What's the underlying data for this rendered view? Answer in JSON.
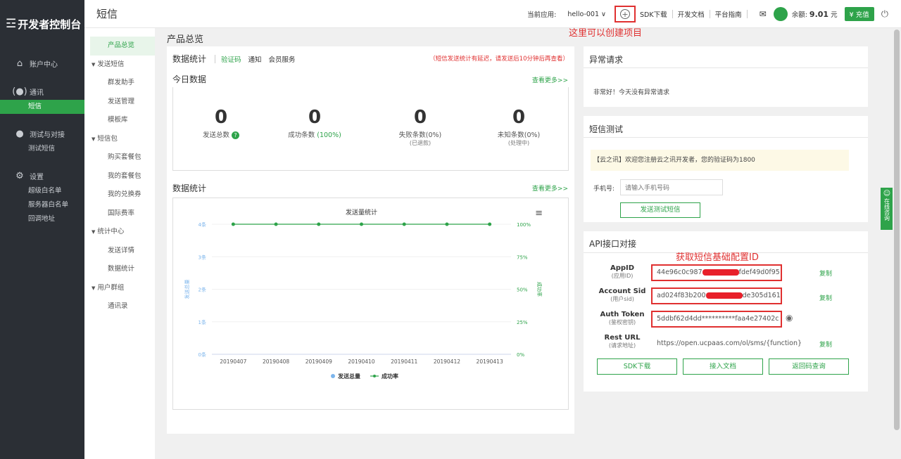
{
  "nav1": {
    "logo": "开发者控制台",
    "groups": [
      {
        "head": "账户中心",
        "subs": []
      },
      {
        "head": "通讯",
        "subs": [
          {
            "label": "短信",
            "active": true
          }
        ]
      },
      {
        "head": "测试与对接",
        "subs": [
          {
            "label": "测试短信",
            "active": false
          }
        ]
      },
      {
        "head": "设置",
        "subs": [
          {
            "label": "超级白名单"
          },
          {
            "label": "服务器白名单"
          },
          {
            "label": "回调地址"
          }
        ]
      }
    ]
  },
  "nav2": {
    "items": [
      {
        "label": "产品总览",
        "type": "item",
        "active": true
      },
      {
        "label": "发送短信",
        "type": "group"
      },
      {
        "label": "群发助手",
        "type": "item"
      },
      {
        "label": "发送管理",
        "type": "item"
      },
      {
        "label": "模板库",
        "type": "item"
      },
      {
        "label": "短信包",
        "type": "group"
      },
      {
        "label": "购买套餐包",
        "type": "item"
      },
      {
        "label": "我的套餐包",
        "type": "item"
      },
      {
        "label": "我的兑换券",
        "type": "item"
      },
      {
        "label": "国际费率",
        "type": "item"
      },
      {
        "label": "统计中心",
        "type": "group"
      },
      {
        "label": "发送详情",
        "type": "item"
      },
      {
        "label": "数据统计",
        "type": "item"
      },
      {
        "label": "用户群组",
        "type": "group"
      },
      {
        "label": "通讯录",
        "type": "item"
      }
    ]
  },
  "header": {
    "title": "短信",
    "current_app_label": "当前应用:",
    "current_app": "hello-001",
    "links": [
      "SDK下载",
      "开发文档",
      "平台指南"
    ],
    "balance_label": "余额:",
    "balance_value": "9.01",
    "balance_unit": "元",
    "charge": "充值"
  },
  "annotations": {
    "create_project": "这里可以创建项目",
    "get_config": "获取短信基础配置ID"
  },
  "page_title": "产品总览",
  "stats_panel": {
    "title": "数据统计",
    "tabs": [
      "验证码",
      "通知",
      "会员服务"
    ],
    "notice": "（短信发送统计有延迟，请发送后10分钟后再查看）"
  },
  "today": {
    "title": "今日数据",
    "more": "查看更多>>",
    "items": [
      {
        "num": "0",
        "label": "发送总数",
        "pct": "",
        "sub": ""
      },
      {
        "num": "0",
        "label": "成功条数",
        "pct": "(100%)",
        "sub": ""
      },
      {
        "num": "0",
        "label": "失败条数(0%)",
        "pct": "",
        "sub": "(已退款)"
      },
      {
        "num": "0",
        "label": "未知条数(0%)",
        "pct": "",
        "sub": "(处理中)"
      }
    ]
  },
  "chart_section": {
    "title": "数据统计",
    "more": "查看更多>>"
  },
  "chart_data": {
    "type": "line",
    "title": "发送量统计",
    "categories": [
      "20190407",
      "20190408",
      "20190409",
      "20190410",
      "20190411",
      "20190412",
      "20190413"
    ],
    "ylabel": "发送总量",
    "y2label": "成功率",
    "y_ticks": [
      "0条",
      "1条",
      "2条",
      "3条",
      "4条"
    ],
    "y2_ticks": [
      "0%",
      "25%",
      "50%",
      "75%",
      "100%"
    ],
    "ylim": [
      0,
      4
    ],
    "y2lim": [
      0,
      100
    ],
    "series": [
      {
        "name": "发送总量",
        "axis": "left",
        "values": [
          0,
          0,
          0,
          0,
          0,
          0,
          0
        ],
        "color": "#7cb5ec"
      },
      {
        "name": "成功率",
        "axis": "right",
        "values": [
          100,
          100,
          100,
          100,
          100,
          100,
          100
        ],
        "color": "#2ea34a"
      }
    ],
    "legend": "bottom"
  },
  "abnormal": {
    "title": "异常请求",
    "text": "非常好！今天没有异常请求"
  },
  "sms_test": {
    "title": "短信测试",
    "preview": "【云之讯】欢迎您注册云之讯开发者，您的验证码为1800",
    "phone_label": "手机号:",
    "phone_placeholder": "请输入手机号码",
    "send": "发送测试短信"
  },
  "api": {
    "title": "API接口对接",
    "rows": [
      {
        "label": "AppID",
        "sub": "(应用ID)",
        "value_a": "44e96c0c987",
        "value_b": "fdef49d0f95",
        "redacted": true,
        "action": "复制"
      },
      {
        "label": "Account Sid",
        "sub": "(用户sid)",
        "value_a": "ad024f83b200",
        "value_b": "de305d1614",
        "redacted": true,
        "action": "复制"
      },
      {
        "label": "Auth Token",
        "sub": "(鉴权密钥)",
        "value_a": "5ddbf62d4dd**********faa4e27402c",
        "value_b": "",
        "redacted": false,
        "action": ""
      },
      {
        "label": "Rest URL",
        "sub": "(请求地址)",
        "value_a": "https://open.ucpaas.com/ol/sms/{function}",
        "value_b": "",
        "redacted": false,
        "action": "复制"
      }
    ],
    "buttons": [
      "SDK下载",
      "接入文档",
      "返回码查询"
    ]
  },
  "float_help": "在线咨询"
}
